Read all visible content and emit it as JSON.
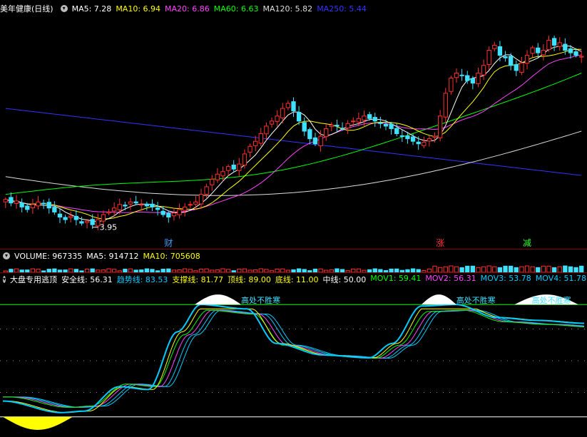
{
  "main_panel": {
    "title": "美年健康(日线)",
    "ma": [
      {
        "label": "MA5: 7.28",
        "color": "#ffffff"
      },
      {
        "label": "MA10: 6.94",
        "color": "#ffff00"
      },
      {
        "label": "MA20: 6.86",
        "color": "#ff44ff"
      },
      {
        "label": "MA60: 6.63",
        "color": "#00ff00"
      },
      {
        "label": "MA120: 5.82",
        "color": "#dddddd"
      },
      {
        "label": "MA250: 5.44",
        "color": "#3333ff"
      }
    ],
    "low_marker": "3.95",
    "event_labels": [
      {
        "text": "财",
        "color": "#40a0ff"
      },
      {
        "text": "涨",
        "color": "#ff3030"
      },
      {
        "text": "减",
        "color": "#30ff30"
      }
    ]
  },
  "volume_panel": {
    "items": [
      {
        "label": "VOLUME: 967335",
        "color": "#ffffff"
      },
      {
        "label": "MA5: 914712",
        "color": "#ffffff"
      },
      {
        "label": "MA10: 705608",
        "color": "#ffff00"
      }
    ]
  },
  "indicator_panel": {
    "title": "大盘专用逃顶",
    "items": [
      {
        "label": "安全线: 56.31",
        "color": "#ffffff"
      },
      {
        "label": "趋势线: 83.53",
        "color": "#00ccff"
      },
      {
        "label": "支撑线: 81.77",
        "color": "#ffff00"
      },
      {
        "label": "顶线: 89.00",
        "color": "#ffff00"
      },
      {
        "label": "底线: 11.00",
        "color": "#ffff00"
      },
      {
        "label": "中线: 50.00",
        "color": "#ffffff"
      },
      {
        "label": "MOV1: 59.41",
        "color": "#00ff00"
      },
      {
        "label": "MOV2: 56.31",
        "color": "#ff44ff"
      },
      {
        "label": "MOV3: 53.78",
        "color": "#00ccff"
      },
      {
        "label": "MOV4: 51.78",
        "color": "#00ccff"
      }
    ],
    "top_text": "高处不胜寒",
    "colors": {
      "line_top": "#00ff00",
      "fill_top": "#ffffff",
      "fill_bottom": "#ffff00"
    }
  },
  "chart_data": {
    "type": "candlestick",
    "title": "美年健康(日线)",
    "price_range": [
      3.6,
      8.0
    ],
    "series": [
      {
        "name": "MA5",
        "latest": 7.28
      },
      {
        "name": "MA10",
        "latest": 6.94
      },
      {
        "name": "MA20",
        "latest": 6.86
      },
      {
        "name": "MA60",
        "latest": 6.63
      },
      {
        "name": "MA120",
        "latest": 5.82
      },
      {
        "name": "MA250",
        "latest": 5.44
      }
    ],
    "closes": [
      4.45,
      4.38,
      4.42,
      4.3,
      4.25,
      4.35,
      4.4,
      4.36,
      4.28,
      4.2,
      4.1,
      4.05,
      4.12,
      4.05,
      3.98,
      4.02,
      3.95,
      4.05,
      4.15,
      4.2,
      4.28,
      4.35,
      4.32,
      4.4,
      4.38,
      4.35,
      4.32,
      4.3,
      4.25,
      4.15,
      4.1,
      4.18,
      4.25,
      4.3,
      4.35,
      4.4,
      4.55,
      4.7,
      4.85,
      4.95,
      5.0,
      5.1,
      5.05,
      5.15,
      5.35,
      5.5,
      5.6,
      5.75,
      5.9,
      6.0,
      6.1,
      6.25,
      6.35,
      6.2,
      6.0,
      5.8,
      5.65,
      5.55,
      5.7,
      5.85,
      5.92,
      5.9,
      5.85,
      5.95,
      6.0,
      6.05,
      6.1,
      6.05,
      6.0,
      5.95,
      5.9,
      5.85,
      5.75,
      5.7,
      5.65,
      5.6,
      5.55,
      5.58,
      5.65,
      5.7,
      6.1,
      6.55,
      6.85,
      6.95,
      6.9,
      6.8,
      6.75,
      6.95,
      7.1,
      7.4,
      7.5,
      7.3,
      7.25,
      7.1,
      7.0,
      7.15,
      7.3,
      7.45,
      7.35,
      7.4,
      7.6,
      7.5,
      7.55,
      7.4,
      7.35,
      7.3,
      7.28
    ],
    "indicator": {
      "name": "大盘专用逃顶",
      "lines": [
        {
          "name": "安全线",
          "value": 56.31
        },
        {
          "name": "趋势线",
          "value": 83.53
        },
        {
          "name": "支撑线",
          "value": 81.77
        },
        {
          "name": "MOV1",
          "value": 59.41
        },
        {
          "name": "MOV2",
          "value": 56.31
        },
        {
          "name": "MOV3",
          "value": 53.78
        },
        {
          "name": "MOV4",
          "value": 51.78
        }
      ],
      "levels": {
        "顶线": 89.0,
        "底线": 11.0,
        "中线": 50.0
      },
      "ylim": [
        0,
        100
      ]
    }
  }
}
